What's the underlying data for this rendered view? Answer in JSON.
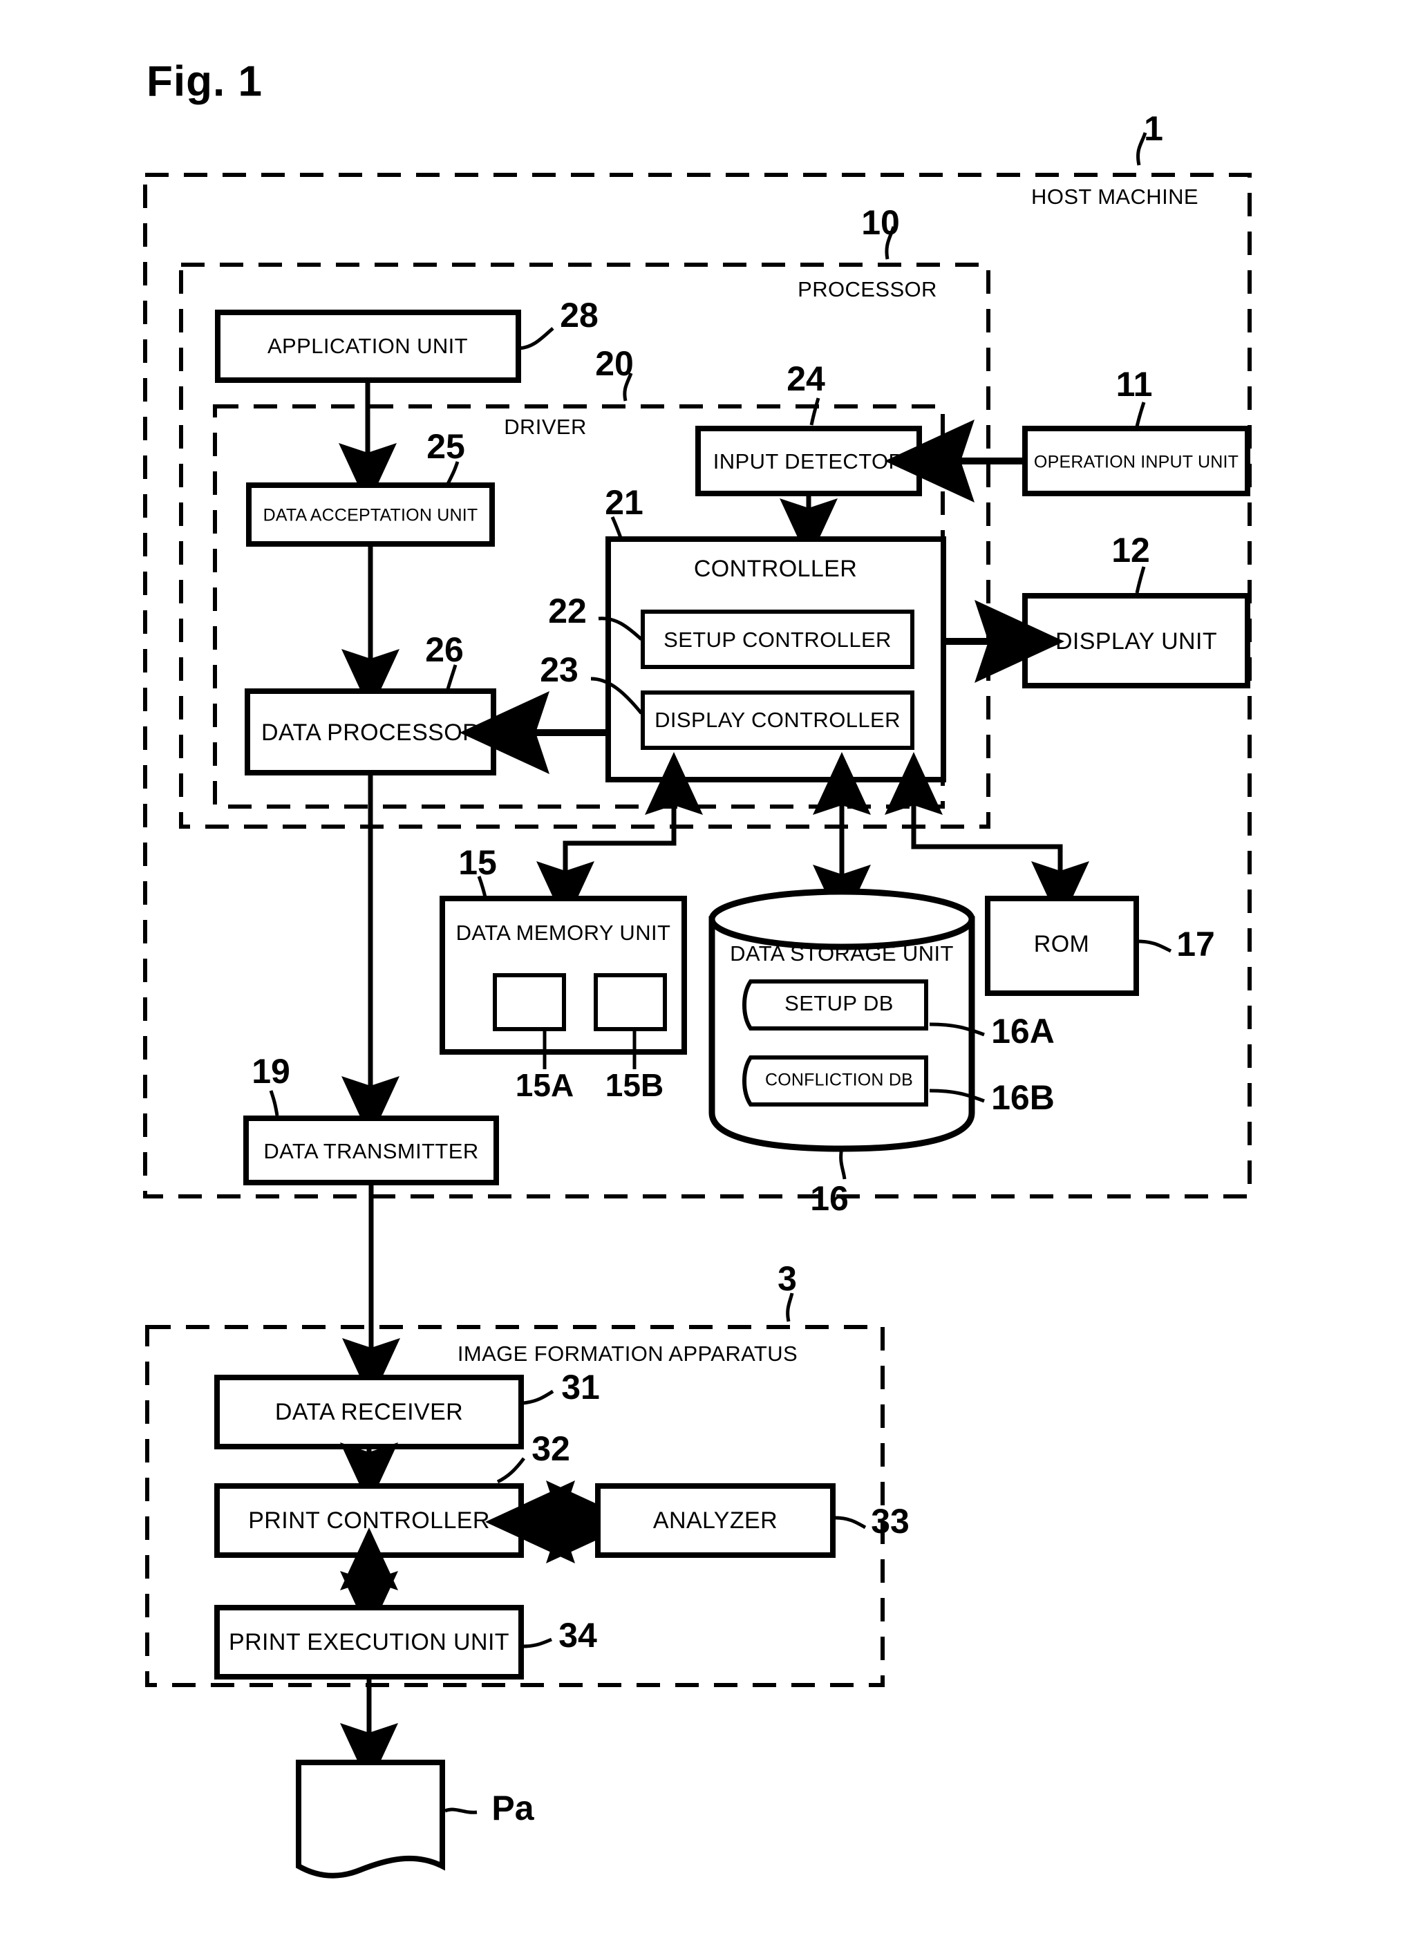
{
  "figure": {
    "title": "Fig. 1"
  },
  "outer_groups": [
    {
      "id": "host",
      "label": "HOST MACHINE",
      "ref": "1"
    },
    {
      "id": "processor",
      "label": "PROCESSOR",
      "ref": "10"
    },
    {
      "id": "driver",
      "label": "DRIVER",
      "ref": "20"
    },
    {
      "id": "apparatus",
      "label": "IMAGE FORMATION APPARATUS",
      "ref": "3"
    }
  ],
  "blocks": {
    "application_unit": {
      "label": "APPLICATION UNIT",
      "ref": "28"
    },
    "data_acceptation_unit": {
      "label": "DATA ACCEPTATION UNIT",
      "ref": "25"
    },
    "data_processor": {
      "label": "DATA PROCESSOR",
      "ref": "26"
    },
    "input_detector": {
      "label": "INPUT DETECTOR",
      "ref": "24"
    },
    "controller": {
      "label": "CONTROLLER",
      "ref": "21"
    },
    "setup_controller": {
      "label": "SETUP CONTROLLER",
      "ref": "22"
    },
    "display_controller": {
      "label": "DISPLAY CONTROLLER",
      "ref": "23"
    },
    "operation_input_unit": {
      "label": "OPERATION INPUT UNIT",
      "ref": "11"
    },
    "display_unit": {
      "label": "DISPLAY UNIT",
      "ref": "12"
    },
    "data_memory_unit": {
      "label": "DATA MEMORY UNIT",
      "ref": "15"
    },
    "memory_slot_a": {
      "label": "",
      "ref": "15A"
    },
    "memory_slot_b": {
      "label": "",
      "ref": "15B"
    },
    "data_storage_unit": {
      "label": "DATA STORAGE UNIT",
      "ref": "16"
    },
    "setup_db": {
      "label": "SETUP DB",
      "ref": "16A"
    },
    "confliction_db": {
      "label": "CONFLICTION DB",
      "ref": "16B"
    },
    "rom": {
      "label": "ROM",
      "ref": "17"
    },
    "data_transmitter": {
      "label": "DATA TRANSMITTER",
      "ref": "19"
    },
    "data_receiver": {
      "label": "DATA RECEIVER",
      "ref": "31"
    },
    "print_controller": {
      "label": "PRINT CONTROLLER",
      "ref": "32"
    },
    "analyzer": {
      "label": "ANALYZER",
      "ref": "33"
    },
    "print_execution_unit": {
      "label": "PRINT EXECUTION UNIT",
      "ref": "34"
    },
    "paper": {
      "label": "",
      "ref": "Pa"
    }
  },
  "colors": {
    "ink": "#000000",
    "paper": "#ffffff"
  }
}
